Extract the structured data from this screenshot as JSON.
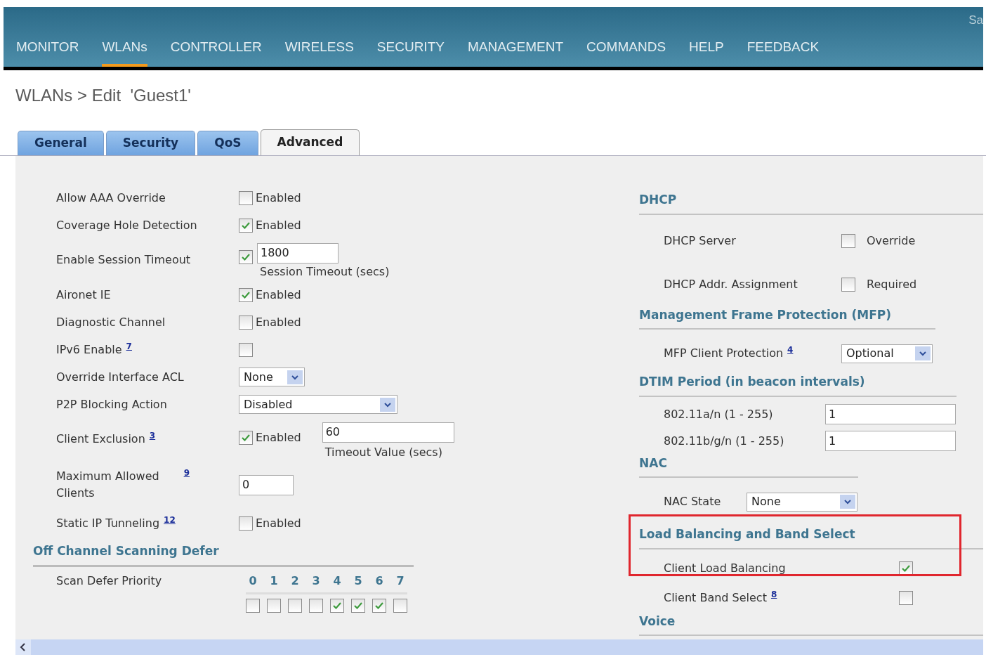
{
  "header": {
    "corner_text": "Sa",
    "menu": [
      {
        "label": "MONITOR",
        "selected": false
      },
      {
        "label": "WLANs",
        "selected": true
      },
      {
        "label": "CONTROLLER",
        "selected": false
      },
      {
        "label": "WIRELESS",
        "selected": false
      },
      {
        "label": "SECURITY",
        "selected": false
      },
      {
        "label": "MANAGEMENT",
        "selected": false
      },
      {
        "label": "COMMANDS",
        "selected": false
      },
      {
        "label": "HELP",
        "selected": false
      },
      {
        "label": "FEEDBACK",
        "selected": false
      }
    ]
  },
  "page_title": "WLANs > Edit  'Guest1'",
  "tabs": [
    {
      "label": "General",
      "selected": false
    },
    {
      "label": "Security",
      "selected": false
    },
    {
      "label": "QoS",
      "selected": false
    },
    {
      "label": "Advanced",
      "selected": true
    }
  ],
  "left_rows": [
    {
      "kind": "checkbox",
      "label": "Allow AAA Override",
      "checked": false,
      "text": "Enabled"
    },
    {
      "kind": "checkbox",
      "label": "Coverage Hole Detection",
      "checked": true,
      "text": "Enabled"
    },
    {
      "kind": "checkbox_field",
      "label": "Enable Session Timeout",
      "checked": true,
      "value": "1800",
      "caption": "Session Timeout (secs)"
    },
    {
      "kind": "checkbox",
      "label": "Aironet IE",
      "checked": true,
      "text": "Enabled"
    },
    {
      "kind": "checkbox",
      "label": "Diagnostic Channel",
      "checked": false,
      "text": "Enabled"
    },
    {
      "kind": "checkbox",
      "label": "IPv6 Enable",
      "note": "7",
      "checked": false
    },
    {
      "kind": "select",
      "label": "Override Interface ACL",
      "value": "None"
    },
    {
      "kind": "select_wide",
      "label": "P2P Blocking Action",
      "value": "Disabled"
    },
    {
      "kind": "checkbox_field",
      "label": "Client Exclusion",
      "note": "3",
      "checked": true,
      "text": "Enabled",
      "value": "60",
      "caption": "Timeout Value (secs)"
    },
    {
      "kind": "input",
      "label": "Maximum Allowed Clients",
      "note": "9",
      "value": "0"
    },
    {
      "kind": "checkbox",
      "label": "Static IP Tunneling",
      "note": "12",
      "checked": false,
      "text": "Enabled"
    }
  ],
  "scan_defer": {
    "heading": "Off Channel Scanning Defer",
    "label": "Scan Defer Priority",
    "priorities": [
      {
        "label": "0",
        "checked": false
      },
      {
        "label": "1",
        "checked": false
      },
      {
        "label": "2",
        "checked": false
      },
      {
        "label": "3",
        "checked": false
      },
      {
        "label": "4",
        "checked": true
      },
      {
        "label": "5",
        "checked": true
      },
      {
        "label": "6",
        "checked": true
      },
      {
        "label": "7",
        "checked": false
      }
    ]
  },
  "right_sections": [
    {
      "heading": "DHCP",
      "highlighted": false,
      "rows": [
        {
          "kind": "checkbox",
          "label": "DHCP Server",
          "checked": false,
          "text": "Override"
        },
        {
          "kind": "checkbox",
          "label": "DHCP Addr. Assignment",
          "checked": false,
          "text": "Required"
        }
      ]
    },
    {
      "heading": "Management Frame Protection (MFP)",
      "highlighted": false,
      "rows": [
        {
          "kind": "select",
          "label": "MFP Client Protection",
          "note": "4",
          "value": "Optional"
        }
      ]
    },
    {
      "heading": "DTIM Period (in beacon intervals)",
      "highlighted": false,
      "rows": [
        {
          "kind": "input",
          "label": "802.11a/n (1 - 255)",
          "value": "1"
        },
        {
          "kind": "input",
          "label": "802.11b/g/n (1 - 255)",
          "value": "1"
        }
      ]
    },
    {
      "heading": "NAC",
      "highlighted": false,
      "rows": [
        {
          "kind": "select",
          "label": "NAC State",
          "value": "None"
        }
      ]
    },
    {
      "heading": "Load Balancing and Band Select",
      "highlighted": true,
      "rows": [
        {
          "kind": "checkbox",
          "label": "Client Load Balancing",
          "checked": true
        }
      ]
    },
    {
      "highlighted": false,
      "rows": [
        {
          "kind": "checkbox",
          "label": "Client Band Select",
          "note": "8",
          "checked": false
        }
      ]
    },
    {
      "heading": "Voice",
      "highlighted": false
    }
  ]
}
